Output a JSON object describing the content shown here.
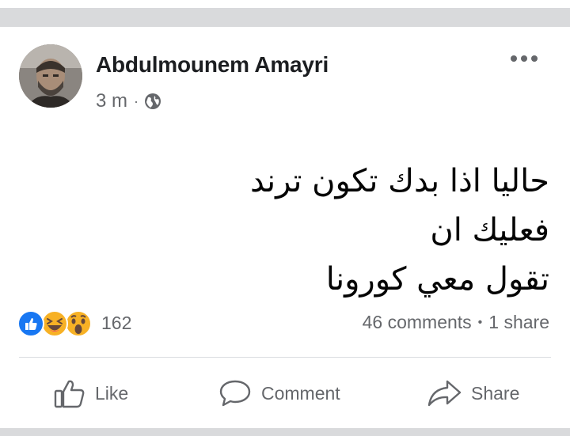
{
  "post": {
    "author": "Abdulmounem Amayri",
    "time": "3 m",
    "separator": "·",
    "text_line1": "حاليا اذا بدك تكون ترند فعليك ان",
    "text_line2": "تقول معي كورونا"
  },
  "reactions": {
    "count": "162",
    "types": [
      "like-icon",
      "haha-icon",
      "wow-icon"
    ]
  },
  "stats": {
    "comments": "46 comments",
    "separator": "•",
    "shares": "1 share"
  },
  "actions": {
    "like": "Like",
    "comment": "Comment",
    "share": "Share"
  },
  "colors": {
    "text_primary": "#1c1e21",
    "text_secondary": "#65676b",
    "like_blue": "#1877f2",
    "emoji_yellow": "#f7b125",
    "band_gray": "#d9dadc"
  }
}
